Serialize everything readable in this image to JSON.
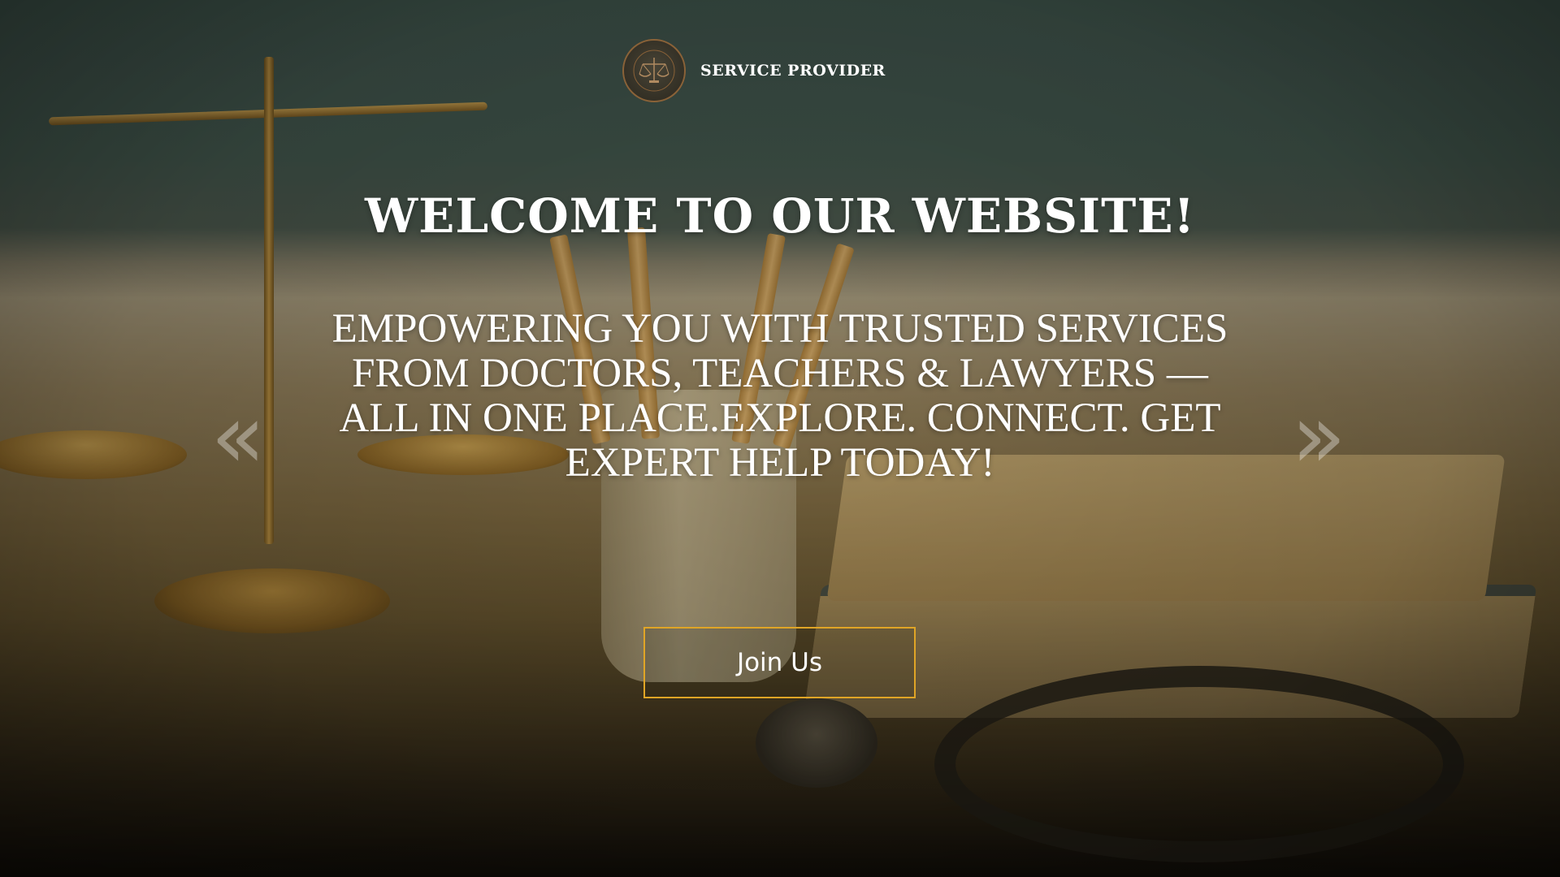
{
  "header": {
    "brand_name": "SERVICE PROVIDER",
    "logo_icon": "scales-emblem-icon"
  },
  "hero": {
    "headline": "WELCOME TO OUR WEBSITE!",
    "tagline": "EMPOWERING YOU WITH TRUSTED SERVICES FROM DOCTORS, TEACHERS & LAWYERS — ALL IN ONE PLACE.EXPLORE. CONNECT. GET EXPERT HELP TODAY!",
    "cta_label": "Join Us",
    "prev_arrow": "«",
    "next_arrow": "»"
  },
  "colors": {
    "cta_border": "#e0a526",
    "text": "#ffffff",
    "logo_border": "#8a6238"
  },
  "icons": {
    "prev": "double-chevron-left-icon",
    "next": "double-chevron-right-icon"
  }
}
